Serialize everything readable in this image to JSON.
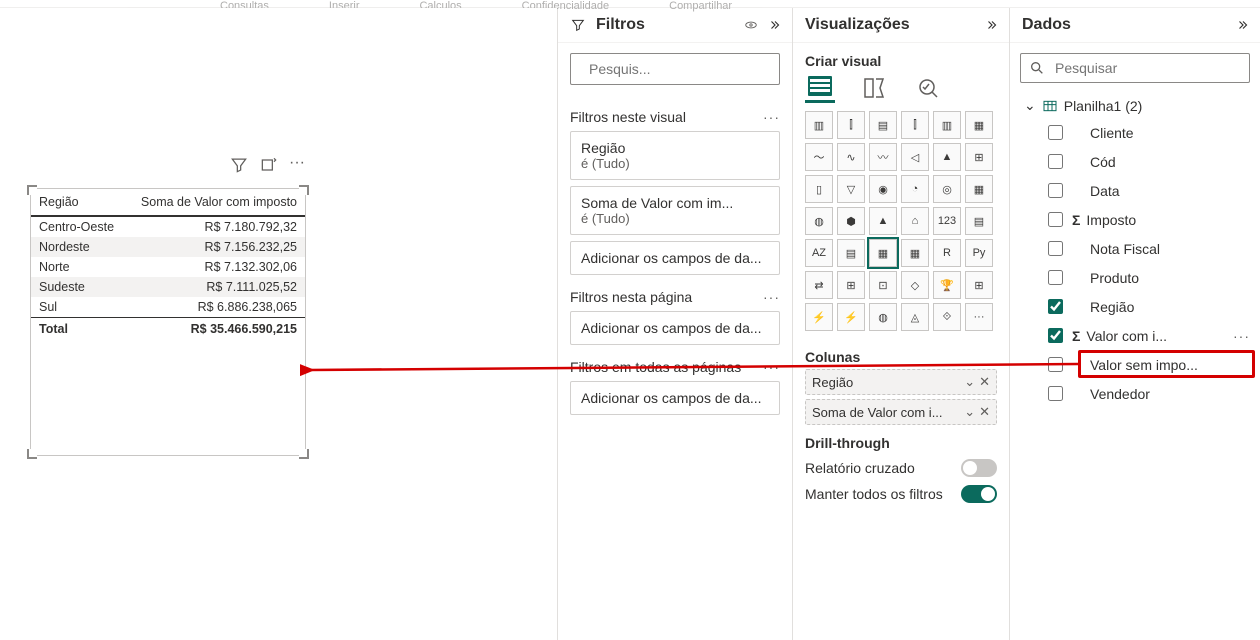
{
  "ribbon_groups": [
    "Consultas",
    "Inserir",
    "Calculos",
    "Confidencialidade",
    "Compartilhar"
  ],
  "filters": {
    "title": "Filtros",
    "search_placeholder": "Pesquis...",
    "sections": {
      "visual": {
        "title": "Filtros neste visual",
        "items": [
          {
            "field": "Região",
            "summary": "é (Tudo)"
          },
          {
            "field": "Soma de Valor com im...",
            "summary": "é (Tudo)"
          }
        ],
        "add_label": "Adicionar os campos de da..."
      },
      "page": {
        "title": "Filtros nesta página",
        "add_label": "Adicionar os campos de da..."
      },
      "all": {
        "title": "Filtros em todas as páginas",
        "add_label": "Adicionar os campos de da..."
      }
    }
  },
  "viz": {
    "title": "Visualizações",
    "subtitle": "Criar visual",
    "wells": {
      "columns_label": "Colunas",
      "items": [
        {
          "name": "Região"
        },
        {
          "name": "Soma de Valor com i..."
        }
      ]
    },
    "drill": {
      "title": "Drill-through",
      "cross": "Relatório cruzado",
      "keep": "Manter todos os filtros"
    }
  },
  "data": {
    "title": "Dados",
    "search_placeholder": "Pesquisar",
    "table": "Planilha1 (2)",
    "fields": [
      {
        "name": "Cliente",
        "checked": false,
        "sigma": false
      },
      {
        "name": "Cód",
        "checked": false,
        "sigma": false
      },
      {
        "name": "Data",
        "checked": false,
        "sigma": false
      },
      {
        "name": "Imposto",
        "checked": false,
        "sigma": true
      },
      {
        "name": "Nota Fiscal",
        "checked": false,
        "sigma": false
      },
      {
        "name": "Produto",
        "checked": false,
        "sigma": false
      },
      {
        "name": "Região",
        "checked": true,
        "sigma": false
      },
      {
        "name": "Valor com i...",
        "checked": true,
        "sigma": true,
        "more": true
      },
      {
        "name": "Valor sem impo...",
        "checked": false,
        "sigma": false
      },
      {
        "name": "Vendedor",
        "checked": false,
        "sigma": false
      }
    ]
  },
  "chart_data": {
    "type": "table",
    "columns": [
      "Região",
      "Soma de Valor com imposto"
    ],
    "rows": [
      [
        "Centro-Oeste",
        "R$ 7.180.792,32"
      ],
      [
        "Nordeste",
        "R$ 7.156.232,25"
      ],
      [
        "Norte",
        "R$ 7.132.302,06"
      ],
      [
        "Sudeste",
        "R$ 7.111.025,52"
      ],
      [
        "Sul",
        "R$ 6.886.238,065"
      ]
    ],
    "total": [
      "Total",
      "R$ 35.466.590,215"
    ]
  }
}
